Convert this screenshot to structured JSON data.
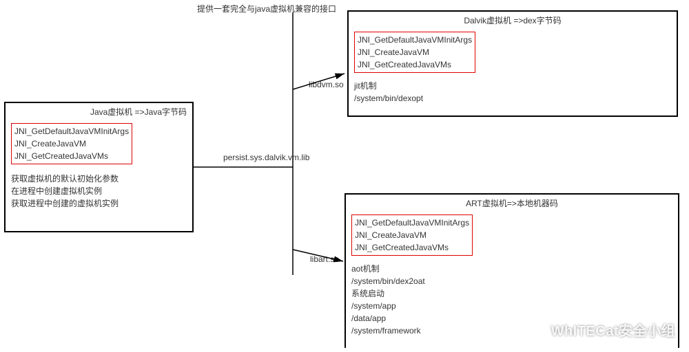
{
  "top_caption": "提供一套完全与java虚拟机兼容的接口",
  "java_box": {
    "title": "Java虚拟机 =>Java字节码",
    "api": [
      "JNI_GetDefaultJavaVMInitArgs",
      "JNI_CreateJavaVM",
      "JNI_GetCreatedJavaVMs"
    ],
    "notes": [
      "获取虚拟机的默认初始化参数",
      "在进程中创建虚拟机实例",
      "获取进程中创建的虚拟机实例"
    ]
  },
  "dalvik_box": {
    "title": "Dalvik虚拟机 =>dex字节码",
    "api": [
      "JNI_GetDefaultJavaVMInitArgs",
      "JNI_CreateJavaVM",
      "JNI_GetCreatedJavaVMs"
    ],
    "notes": [
      "jit机制",
      "/system/bin/dexopt"
    ]
  },
  "art_box": {
    "title": "ART虚拟机=>本地机器码",
    "api": [
      "JNI_GetDefaultJavaVMInitArgs",
      "JNI_CreateJavaVM",
      "JNI_GetCreatedJavaVMs"
    ],
    "notes": [
      "aot机制",
      "/system/bin/dex2oat",
      "系统启动",
      "/system/app",
      "/data/app",
      "/system/framework"
    ]
  },
  "edge_center": "persist.sys.dalvik.vm.lib",
  "edge_top": "libdvm.so",
  "edge_bottom": "libart.so",
  "watermark": "WhITECat安全小组"
}
